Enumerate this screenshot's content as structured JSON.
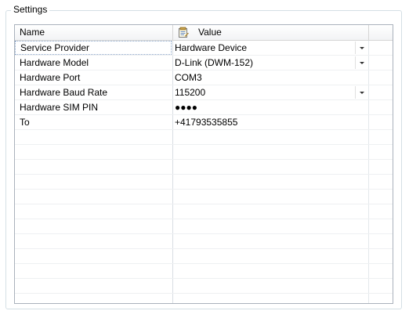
{
  "group": {
    "title": "Settings"
  },
  "grid": {
    "columns": {
      "name": "Name",
      "value": "Value"
    },
    "rows": [
      {
        "name": "Service Provider",
        "value": "Hardware Device",
        "dropdown": true
      },
      {
        "name": "Hardware Model",
        "value": "D-Link (DWM-152)",
        "dropdown": true
      },
      {
        "name": "Hardware Port",
        "value": "COM3",
        "dropdown": false
      },
      {
        "name": "Hardware Baud Rate",
        "value": "115200",
        "dropdown": true
      },
      {
        "name": "Hardware SIM PIN",
        "value": "●●●●",
        "dropdown": false
      },
      {
        "name": "To",
        "value": "+41793535855",
        "dropdown": false
      }
    ]
  },
  "icons": {
    "value_header": "notepad-icon",
    "dropdown": "chevron-down-icon"
  }
}
